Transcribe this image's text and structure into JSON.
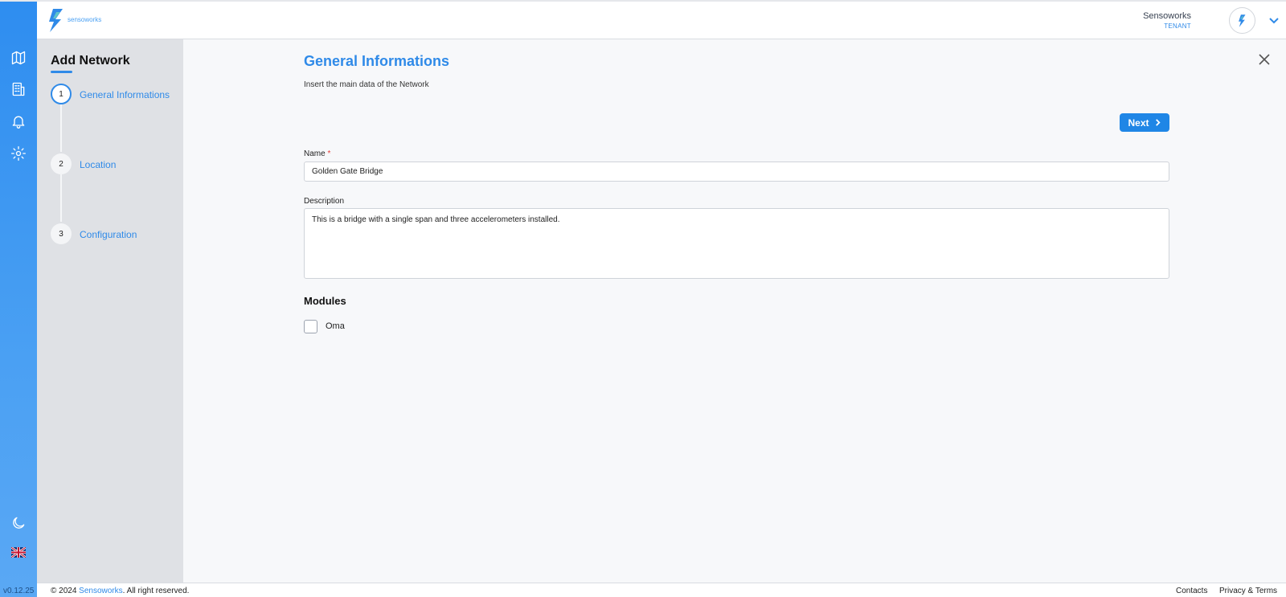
{
  "app": {
    "brand": "sensoworks",
    "version": "v0.12.25"
  },
  "header": {
    "user_name": "Sensoworks",
    "user_role": "TENANT"
  },
  "rail": {
    "icons": [
      "map-icon",
      "building-icon",
      "bell-icon",
      "gear-icon",
      "moon-icon",
      "uk-flag-icon"
    ]
  },
  "stepper": {
    "title": "Add Network",
    "steps": [
      {
        "number": "1",
        "label": "General Informations",
        "active": true
      },
      {
        "number": "2",
        "label": "Location",
        "active": false
      },
      {
        "number": "3",
        "label": "Configuration",
        "active": false
      }
    ]
  },
  "form": {
    "title": "General Informations",
    "subtitle": "Insert the main data of the Network",
    "next_label": "Next",
    "name_label": "Name",
    "required_mark": "*",
    "name_value": "Golden Gate Bridge",
    "description_label": "Description",
    "description_value": "This is a bridge with a single span and three accelerometers installed.",
    "modules_title": "Modules",
    "modules": [
      {
        "label": "Oma",
        "checked": false
      }
    ]
  },
  "footer": {
    "copy_prefix": "© 2024 ",
    "copy_link": "Sensoworks",
    "copy_suffix": ". All right reserved.",
    "contacts": "Contacts",
    "privacy": "Privacy & Terms"
  },
  "colors": {
    "accent": "#2f8ae8",
    "rail_top": "#2e8df0",
    "stepper_bg": "#dfe1e5",
    "required": "#e53935"
  }
}
